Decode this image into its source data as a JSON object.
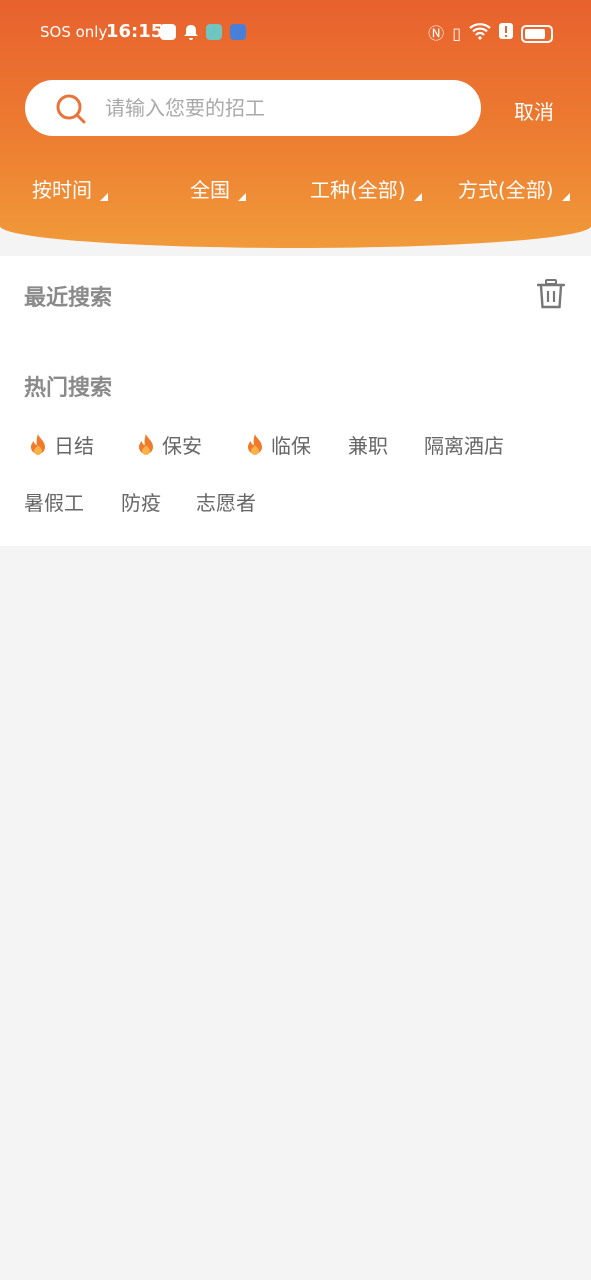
{
  "status_bar": {
    "carrier": "SOS only",
    "time": "16:15"
  },
  "search": {
    "placeholder": "请输入您要的招工",
    "cancel_label": "取消"
  },
  "filters": [
    {
      "label": "按时间"
    },
    {
      "label": "全国"
    },
    {
      "label": "工种(全部)"
    },
    {
      "label": "方式(全部)"
    }
  ],
  "recent": {
    "title": "最近搜索"
  },
  "hot": {
    "title": "热门搜索",
    "tags": [
      {
        "label": "日结",
        "hot": true
      },
      {
        "label": "保安",
        "hot": true
      },
      {
        "label": "临保",
        "hot": true
      },
      {
        "label": "兼职",
        "hot": false
      },
      {
        "label": "隔离酒店",
        "hot": false
      },
      {
        "label": "暑假工",
        "hot": false
      },
      {
        "label": "防疫",
        "hot": false
      },
      {
        "label": "志愿者",
        "hot": false
      }
    ]
  },
  "colors": {
    "header_start": "#e8612e",
    "header_end": "#f19a3a",
    "flame": "#f07a2a"
  }
}
